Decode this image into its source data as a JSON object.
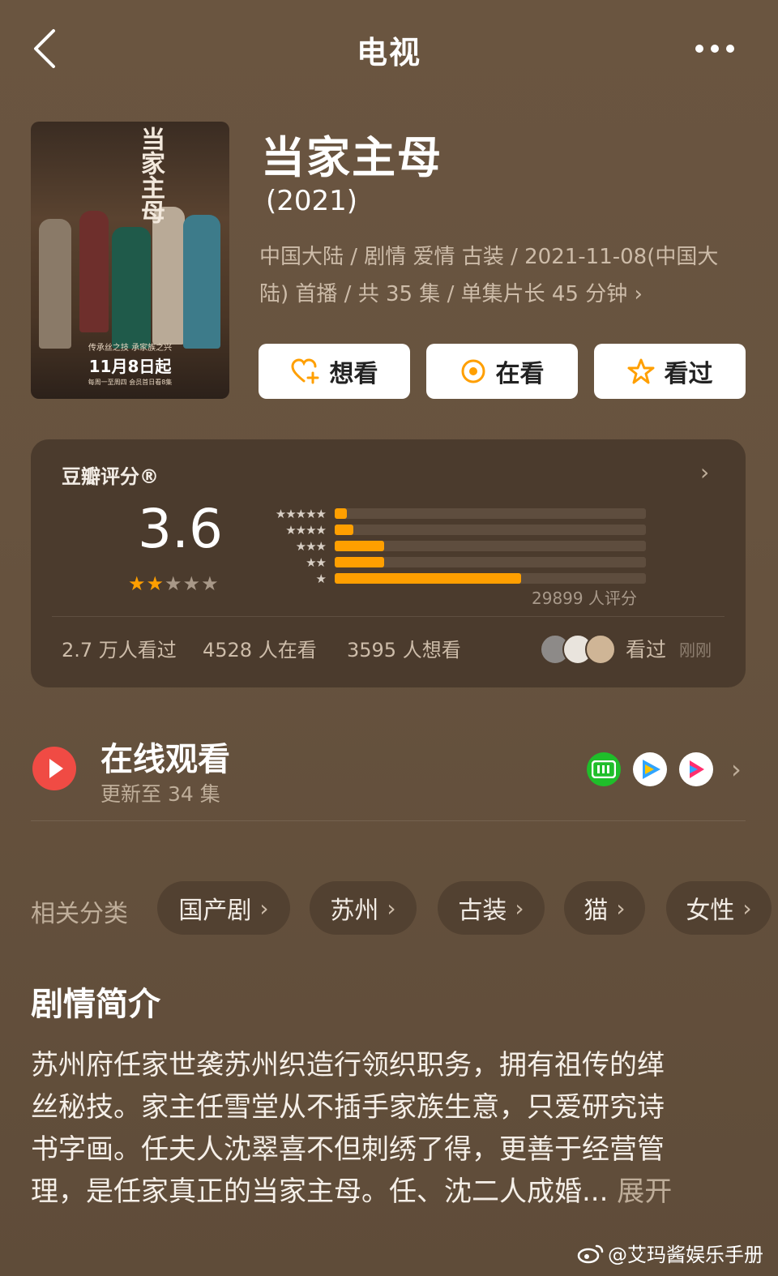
{
  "header": {
    "title": "电视",
    "back_icon": "chevron-left-icon",
    "more_icon": "more-dots-icon"
  },
  "show": {
    "poster": {
      "title": "当家主母",
      "sub": "传承丝之技 承家族之兴",
      "date": "11月8日起",
      "small": "每周一至周四 会员首日看8集"
    },
    "title": "当家主母",
    "year": "(2021)",
    "meta_line1": "中国大陆 / 剧情 爱情 古装 / 2021-11-08(中国大",
    "meta_line2": "陆) 首播 / 共 35 集 / 单集片长 45 分钟"
  },
  "actions": [
    {
      "label": "想看",
      "icon": "heart-plus-icon"
    },
    {
      "label": "在看",
      "icon": "target-circle-icon"
    },
    {
      "label": "看过",
      "icon": "star-outline-icon"
    }
  ],
  "rating": {
    "label": "豆瓣评分®",
    "score": "3.6",
    "stars_filled": 2,
    "stars_total": 5,
    "distribution": [
      {
        "stars": "★★★★★",
        "fraction": 0.04
      },
      {
        "stars": "★★★★",
        "fraction": 0.06
      },
      {
        "stars": "★★★",
        "fraction": 0.16
      },
      {
        "stars": "★★",
        "fraction": 0.16
      },
      {
        "stars": "★",
        "fraction": 0.6
      }
    ],
    "count": "29899 人评分",
    "watched": "2.7 万人看过",
    "watching": "4528 人在看",
    "want": "3595 人想看",
    "friend_action": "看过",
    "friend_time": "刚刚"
  },
  "online": {
    "title": "在线观看",
    "subtitle": "更新至 34 集",
    "platforms": [
      {
        "name": "iqiyi-icon",
        "color": "#1fbe2a"
      },
      {
        "name": "tencent-video-icon",
        "color": "#2fa4ff"
      },
      {
        "name": "youku-icon",
        "color": "#ff2f6e"
      }
    ]
  },
  "categories": {
    "label": "相关分类",
    "tags": [
      "国产剧",
      "苏州",
      "古装",
      "猫",
      "女性"
    ]
  },
  "synopsis": {
    "title": "剧情简介",
    "line1": "苏州府任家世袭苏州织造行领织职务，拥有祖传的缂",
    "line2": "丝秘技。家主任雪堂从不插手家族生意，只爱研究诗",
    "line3": "书字画。任夫人沈翠喜不但刺绣了得，更善于经营管",
    "line4": "理，是任家真正的当家主母。任、沈二人成婚...",
    "more": "展开"
  },
  "watermark": "@艾玛酱娱乐手册",
  "colors": {
    "accent": "#ff9f00",
    "background": "#67533f",
    "card": "#4b3b2d"
  }
}
